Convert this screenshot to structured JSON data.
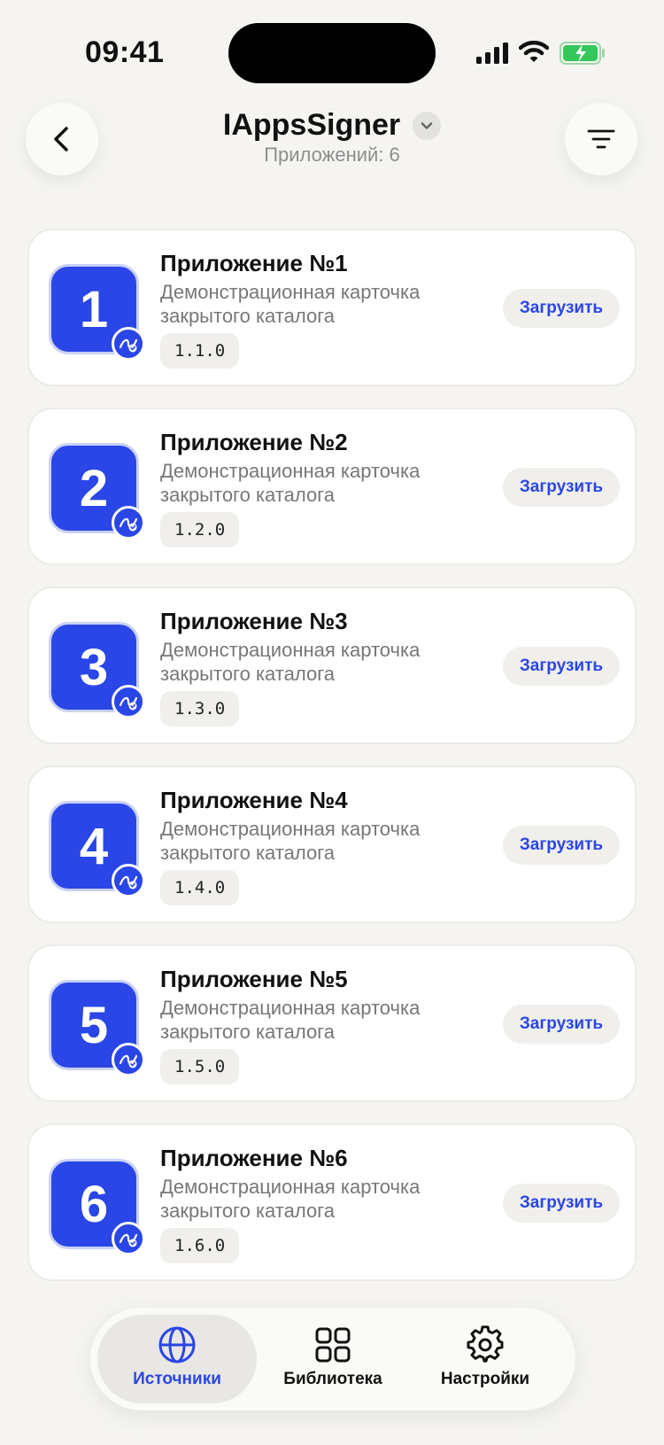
{
  "status_bar": {
    "time": "09:41"
  },
  "header": {
    "title": "IAppsSigner",
    "subtitle": "Приложений: 6"
  },
  "apps": [
    {
      "number": "1",
      "name": "Приложение №1",
      "description": "Демонстрационная карточка закрытого каталога",
      "version": "1.1.0",
      "action": "Загрузить"
    },
    {
      "number": "2",
      "name": "Приложение №2",
      "description": "Демонстрационная карточка закрытого каталога",
      "version": "1.2.0",
      "action": "Загрузить"
    },
    {
      "number": "3",
      "name": "Приложение №3",
      "description": "Демонстрационная карточка закрытого каталога",
      "version": "1.3.0",
      "action": "Загрузить"
    },
    {
      "number": "4",
      "name": "Приложение №4",
      "description": "Демонстрационная карточка закрытого каталога",
      "version": "1.4.0",
      "action": "Загрузить"
    },
    {
      "number": "5",
      "name": "Приложение №5",
      "description": "Демонстрационная карточка закрытого каталога",
      "version": "1.5.0",
      "action": "Загрузить"
    },
    {
      "number": "6",
      "name": "Приложение №6",
      "description": "Демонстрационная карточка закрытого каталога",
      "version": "1.6.0",
      "action": "Загрузить"
    }
  ],
  "tabs": [
    {
      "label": "Источники",
      "icon": "globe-icon",
      "active": true
    },
    {
      "label": "Библиотека",
      "icon": "grid-icon",
      "active": false
    },
    {
      "label": "Настройки",
      "icon": "gear-icon",
      "active": false
    }
  ],
  "colors": {
    "accent": "#2a46e6",
    "background": "#f5f4f1",
    "battery": "#34c759"
  }
}
